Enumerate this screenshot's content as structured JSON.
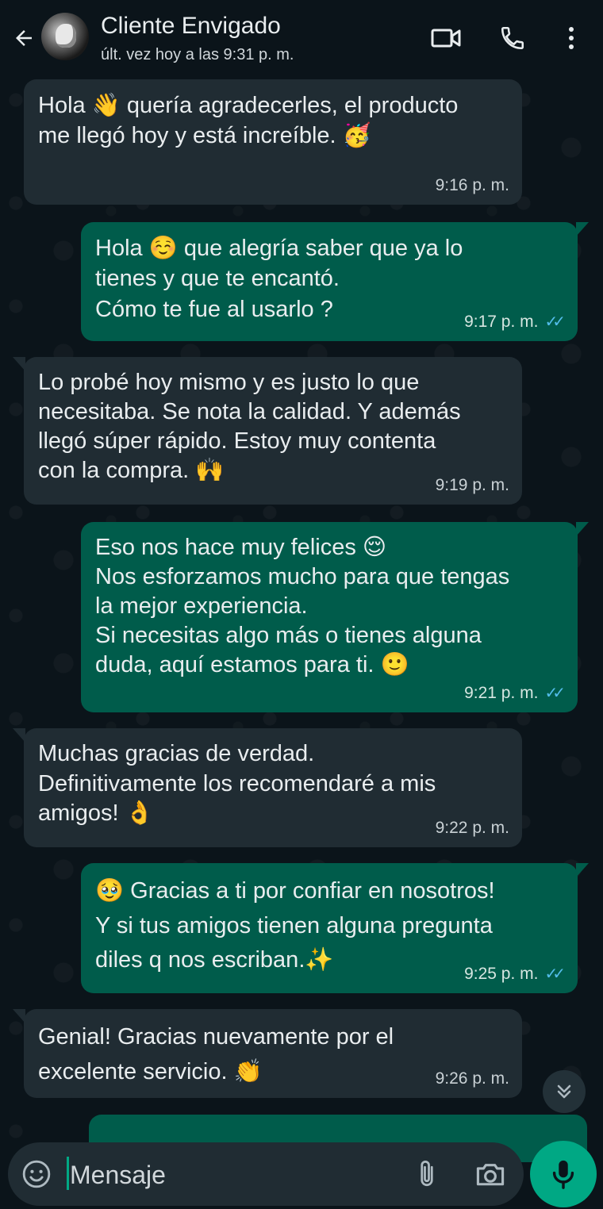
{
  "header": {
    "contact_name": "Cliente Envigado",
    "last_seen": "últ. vez hoy a las 9:31 p. m."
  },
  "messages": [
    {
      "dir": "in",
      "text": "Hola 👋 quería agradecerles, el producto\nme llegó hoy y está increíble. 🥳",
      "time": "9:16 p. m."
    },
    {
      "dir": "out",
      "text": "Hola ☺️ que alegría saber que ya lo\ntienes y que  te encantó.\nCómo te fue al usarlo ?",
      "time": "9:17 p. m.",
      "ticks": "✓✓"
    },
    {
      "dir": "in",
      "text": "Lo probé hoy mismo y es justo lo que\nnecesitaba. Se nota la calidad.  Y además\nllegó súper rápido. Estoy muy contenta\ncon la compra. 🙌",
      "time": "9:19 p. m."
    },
    {
      "dir": "out",
      "text": "Eso nos hace muy felices 😌\nNos esforzamos mucho para que tengas\nla mejor experiencia.\nSi necesitas algo más o tienes alguna\nduda, aquí estamos para ti. 🙂",
      "time": "9:21 p. m.",
      "ticks": "✓✓"
    },
    {
      "dir": "in",
      "text": "Muchas gracias de verdad.\nDefinitivamente los recomendaré a mis\namigos! 👌",
      "time": "9:22 p. m."
    },
    {
      "dir": "out",
      "text": "🥹 Gracias a ti por confiar en nosotros!\nY si tus amigos tienen alguna pregunta\ndiles q nos escriban.✨",
      "time": "9:25 p. m.",
      "ticks": "✓✓"
    },
    {
      "dir": "in",
      "text": "Genial! Gracias nuevamente por el\nexcelente servicio. 👏",
      "time": "9:26 p. m."
    }
  ],
  "input": {
    "placeholder": "Mensaje"
  },
  "colors": {
    "background": "#0b141a",
    "incoming_bubble": "#202c33",
    "outgoing_bubble": "#005c4b",
    "accent": "#00a884",
    "read_ticks": "#53bdeb"
  },
  "icons": [
    "back-arrow-icon",
    "video-call-icon",
    "phone-icon",
    "more-options-icon",
    "emoji-icon",
    "attach-icon",
    "camera-icon",
    "mic-icon",
    "chevron-double-down-icon"
  ]
}
